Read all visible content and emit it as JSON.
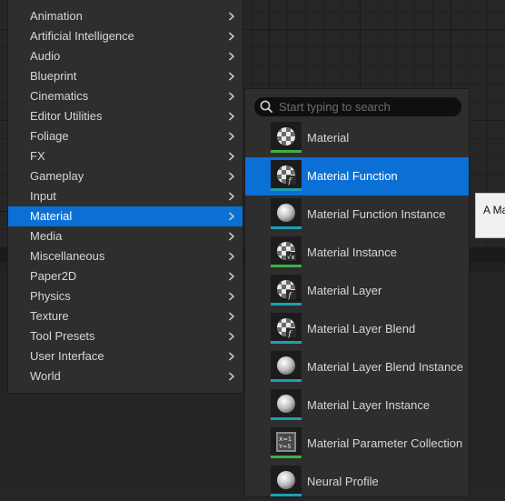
{
  "menu": {
    "items": [
      {
        "label": "Animation",
        "selected": false
      },
      {
        "label": "Artificial Intelligence",
        "selected": false
      },
      {
        "label": "Audio",
        "selected": false
      },
      {
        "label": "Blueprint",
        "selected": false
      },
      {
        "label": "Cinematics",
        "selected": false
      },
      {
        "label": "Editor Utilities",
        "selected": false
      },
      {
        "label": "Foliage",
        "selected": false
      },
      {
        "label": "FX",
        "selected": false
      },
      {
        "label": "Gameplay",
        "selected": false
      },
      {
        "label": "Input",
        "selected": false
      },
      {
        "label": "Material",
        "selected": true
      },
      {
        "label": "Media",
        "selected": false
      },
      {
        "label": "Miscellaneous",
        "selected": false
      },
      {
        "label": "Paper2D",
        "selected": false
      },
      {
        "label": "Physics",
        "selected": false
      },
      {
        "label": "Texture",
        "selected": false
      },
      {
        "label": "Tool Presets",
        "selected": false
      },
      {
        "label": "User Interface",
        "selected": false
      },
      {
        "label": "World",
        "selected": false
      }
    ]
  },
  "submenu": {
    "search": {
      "placeholder": "Start typing to search",
      "value": ""
    },
    "items": [
      {
        "label": "Material",
        "icon": "material-checker-icon",
        "accent": "#3fb046",
        "selected": false
      },
      {
        "label": "Material Function",
        "icon": "material-function-icon",
        "accent": "#1e9fb3",
        "selected": true
      },
      {
        "label": "Material Function Instance",
        "icon": "material-sphere-icon",
        "accent": "#1e9fb3",
        "selected": false
      },
      {
        "label": "Material Instance",
        "icon": "material-instance-icon",
        "accent": "#3fb046",
        "selected": false
      },
      {
        "label": "Material Layer",
        "icon": "material-function-icon",
        "accent": "#1e9fb3",
        "selected": false
      },
      {
        "label": "Material Layer Blend",
        "icon": "material-function-icon",
        "accent": "#1e9fb3",
        "selected": false
      },
      {
        "label": "Material Layer Blend Instance",
        "icon": "material-sphere-icon",
        "accent": "#1e9fb3",
        "selected": false
      },
      {
        "label": "Material Layer Instance",
        "icon": "material-sphere-icon",
        "accent": "#1e9fb3",
        "selected": false
      },
      {
        "label": "Material Parameter Collection",
        "icon": "parameter-collection-icon",
        "accent": "#3fb046",
        "selected": false
      },
      {
        "label": "Neural Profile",
        "icon": "material-sphere-icon",
        "accent": "#1e9fb3",
        "selected": false
      }
    ]
  },
  "tooltip": {
    "text": "A Ma"
  },
  "colors": {
    "selection": "#0a70d6",
    "menu_bg": "#2e2e2e"
  }
}
